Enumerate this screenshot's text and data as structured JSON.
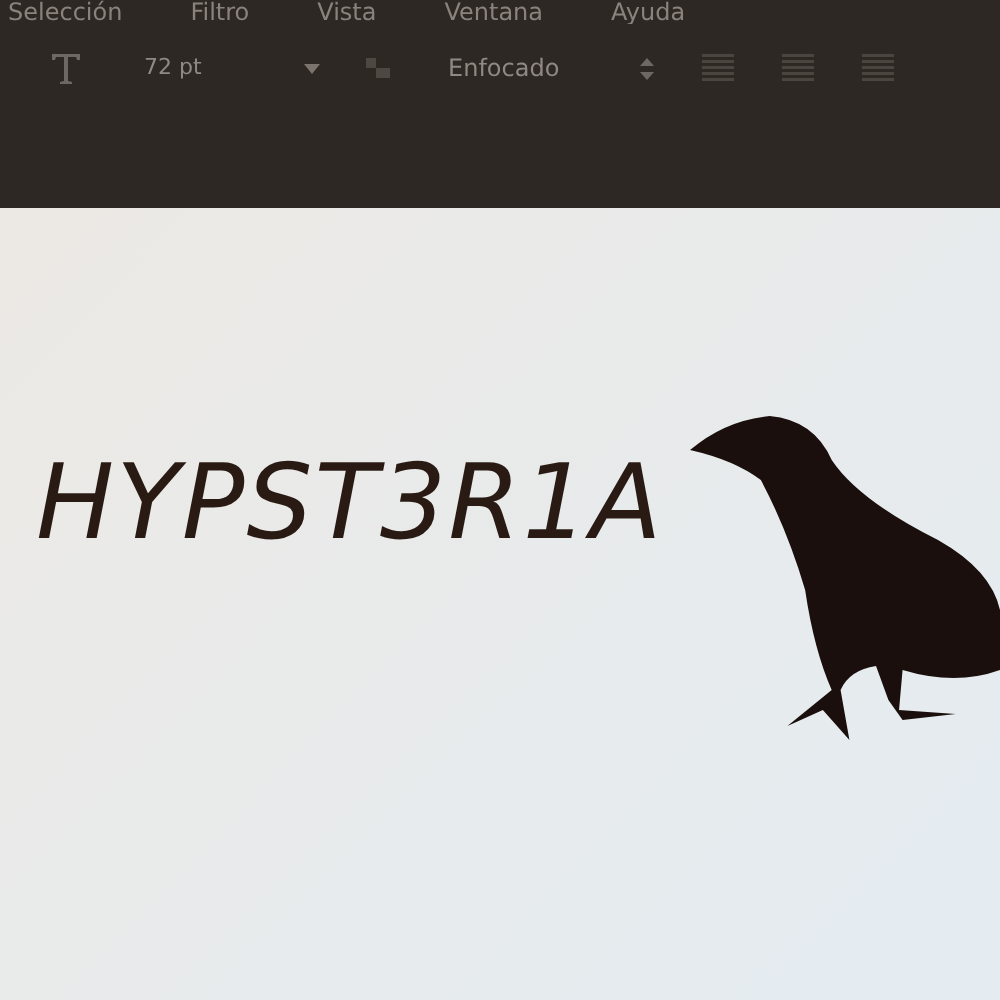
{
  "menu_bar": [
    "Selección",
    "Filtro",
    "Vista",
    "Ventana",
    "Ayuda"
  ],
  "toolbar": {
    "font_size": "72 pt",
    "antialias": "Enfocado"
  },
  "canvas": {
    "text": "HYPST3R1A"
  }
}
